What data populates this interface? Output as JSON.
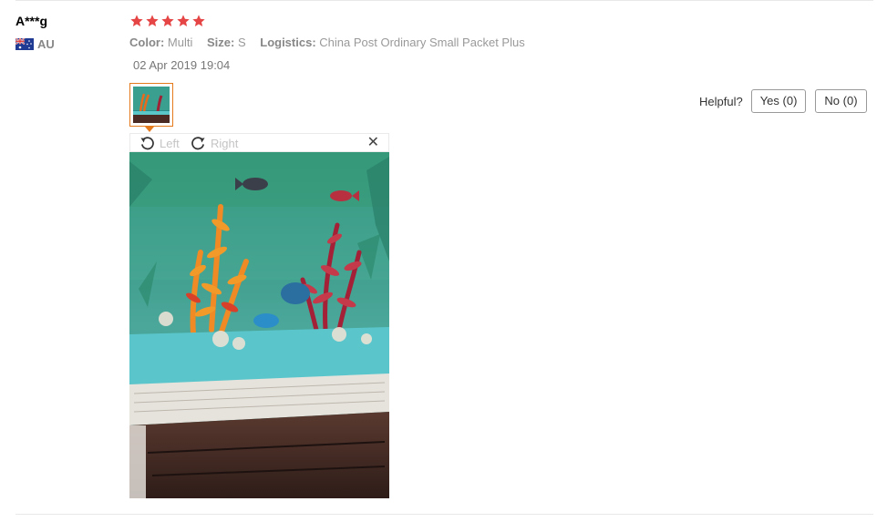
{
  "review": {
    "user": {
      "name": "A***g",
      "country": "AU",
      "flag_icon": "australia-flag-icon"
    },
    "rating": {
      "value": 5,
      "max": 5,
      "color": "#e64545"
    },
    "attributes": {
      "color_label": "Color:",
      "color_value": "Multi",
      "size_label": "Size:",
      "size_value": "S",
      "logistics_label": "Logistics:",
      "logistics_value": "China Post Ordinary Small Packet Plus"
    },
    "date": "02 Apr 2019 19:04",
    "helpful": {
      "label": "Helpful?",
      "yes": "Yes (0)",
      "no": "No (0)"
    },
    "viewer": {
      "rotate_left": "Left",
      "rotate_right": "Right",
      "close": "✕",
      "photo_subject": "aquarium-photo"
    }
  },
  "colors": {
    "accent": "#e57a1c",
    "star": "#e64545"
  }
}
